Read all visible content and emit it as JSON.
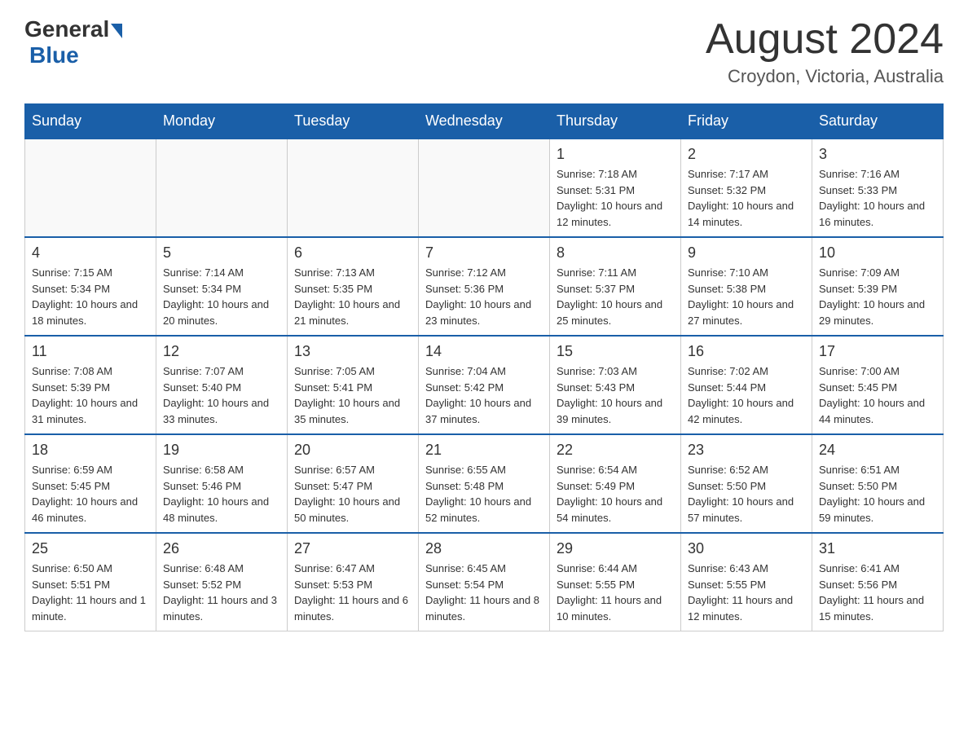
{
  "header": {
    "logo": {
      "general": "General",
      "blue": "Blue"
    },
    "title": "August 2024",
    "location": "Croydon, Victoria, Australia"
  },
  "calendar": {
    "days": [
      "Sunday",
      "Monday",
      "Tuesday",
      "Wednesday",
      "Thursday",
      "Friday",
      "Saturday"
    ],
    "weeks": [
      [
        {
          "day": "",
          "info": ""
        },
        {
          "day": "",
          "info": ""
        },
        {
          "day": "",
          "info": ""
        },
        {
          "day": "",
          "info": ""
        },
        {
          "day": "1",
          "info": "Sunrise: 7:18 AM\nSunset: 5:31 PM\nDaylight: 10 hours and 12 minutes."
        },
        {
          "day": "2",
          "info": "Sunrise: 7:17 AM\nSunset: 5:32 PM\nDaylight: 10 hours and 14 minutes."
        },
        {
          "day": "3",
          "info": "Sunrise: 7:16 AM\nSunset: 5:33 PM\nDaylight: 10 hours and 16 minutes."
        }
      ],
      [
        {
          "day": "4",
          "info": "Sunrise: 7:15 AM\nSunset: 5:34 PM\nDaylight: 10 hours and 18 minutes."
        },
        {
          "day": "5",
          "info": "Sunrise: 7:14 AM\nSunset: 5:34 PM\nDaylight: 10 hours and 20 minutes."
        },
        {
          "day": "6",
          "info": "Sunrise: 7:13 AM\nSunset: 5:35 PM\nDaylight: 10 hours and 21 minutes."
        },
        {
          "day": "7",
          "info": "Sunrise: 7:12 AM\nSunset: 5:36 PM\nDaylight: 10 hours and 23 minutes."
        },
        {
          "day": "8",
          "info": "Sunrise: 7:11 AM\nSunset: 5:37 PM\nDaylight: 10 hours and 25 minutes."
        },
        {
          "day": "9",
          "info": "Sunrise: 7:10 AM\nSunset: 5:38 PM\nDaylight: 10 hours and 27 minutes."
        },
        {
          "day": "10",
          "info": "Sunrise: 7:09 AM\nSunset: 5:39 PM\nDaylight: 10 hours and 29 minutes."
        }
      ],
      [
        {
          "day": "11",
          "info": "Sunrise: 7:08 AM\nSunset: 5:39 PM\nDaylight: 10 hours and 31 minutes."
        },
        {
          "day": "12",
          "info": "Sunrise: 7:07 AM\nSunset: 5:40 PM\nDaylight: 10 hours and 33 minutes."
        },
        {
          "day": "13",
          "info": "Sunrise: 7:05 AM\nSunset: 5:41 PM\nDaylight: 10 hours and 35 minutes."
        },
        {
          "day": "14",
          "info": "Sunrise: 7:04 AM\nSunset: 5:42 PM\nDaylight: 10 hours and 37 minutes."
        },
        {
          "day": "15",
          "info": "Sunrise: 7:03 AM\nSunset: 5:43 PM\nDaylight: 10 hours and 39 minutes."
        },
        {
          "day": "16",
          "info": "Sunrise: 7:02 AM\nSunset: 5:44 PM\nDaylight: 10 hours and 42 minutes."
        },
        {
          "day": "17",
          "info": "Sunrise: 7:00 AM\nSunset: 5:45 PM\nDaylight: 10 hours and 44 minutes."
        }
      ],
      [
        {
          "day": "18",
          "info": "Sunrise: 6:59 AM\nSunset: 5:45 PM\nDaylight: 10 hours and 46 minutes."
        },
        {
          "day": "19",
          "info": "Sunrise: 6:58 AM\nSunset: 5:46 PM\nDaylight: 10 hours and 48 minutes."
        },
        {
          "day": "20",
          "info": "Sunrise: 6:57 AM\nSunset: 5:47 PM\nDaylight: 10 hours and 50 minutes."
        },
        {
          "day": "21",
          "info": "Sunrise: 6:55 AM\nSunset: 5:48 PM\nDaylight: 10 hours and 52 minutes."
        },
        {
          "day": "22",
          "info": "Sunrise: 6:54 AM\nSunset: 5:49 PM\nDaylight: 10 hours and 54 minutes."
        },
        {
          "day": "23",
          "info": "Sunrise: 6:52 AM\nSunset: 5:50 PM\nDaylight: 10 hours and 57 minutes."
        },
        {
          "day": "24",
          "info": "Sunrise: 6:51 AM\nSunset: 5:50 PM\nDaylight: 10 hours and 59 minutes."
        }
      ],
      [
        {
          "day": "25",
          "info": "Sunrise: 6:50 AM\nSunset: 5:51 PM\nDaylight: 11 hours and 1 minute."
        },
        {
          "day": "26",
          "info": "Sunrise: 6:48 AM\nSunset: 5:52 PM\nDaylight: 11 hours and 3 minutes."
        },
        {
          "day": "27",
          "info": "Sunrise: 6:47 AM\nSunset: 5:53 PM\nDaylight: 11 hours and 6 minutes."
        },
        {
          "day": "28",
          "info": "Sunrise: 6:45 AM\nSunset: 5:54 PM\nDaylight: 11 hours and 8 minutes."
        },
        {
          "day": "29",
          "info": "Sunrise: 6:44 AM\nSunset: 5:55 PM\nDaylight: 11 hours and 10 minutes."
        },
        {
          "day": "30",
          "info": "Sunrise: 6:43 AM\nSunset: 5:55 PM\nDaylight: 11 hours and 12 minutes."
        },
        {
          "day": "31",
          "info": "Sunrise: 6:41 AM\nSunset: 5:56 PM\nDaylight: 11 hours and 15 minutes."
        }
      ]
    ]
  }
}
